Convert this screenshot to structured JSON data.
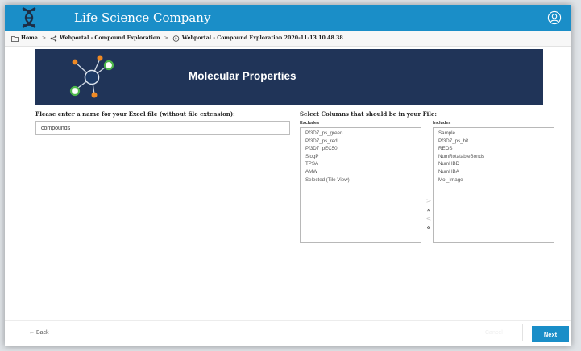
{
  "app": {
    "title": "Life Science Company",
    "brand_color": "#1a8ec8",
    "banner_color": "#203458"
  },
  "breadcrumb": {
    "home": "Home",
    "item1": "Webportal - Compound Exploration",
    "item2": "Webportal - Compound Exploration 2020-11-13 10.48.38"
  },
  "banner": {
    "title": "Molecular Properties"
  },
  "filename": {
    "label": "Please enter a name for your Excel file (without file extension):",
    "value": "compounds"
  },
  "columns": {
    "label": "Select Columns that should be in your File:",
    "excludes_header": "Excludes",
    "includes_header": "Includes",
    "excludes": [
      "Pf3D7_ps_green",
      "Pf3D7_ps_red",
      "Pf3D7_pEC50",
      "SlogP",
      "TPSA",
      "AMW",
      "Selected (Tile View)"
    ],
    "includes": [
      "Sample",
      "Pf3D7_ps_hit",
      "REOS",
      "NumRotatableBonds",
      "NumHBD",
      "NumHBA",
      "Mol_Image"
    ],
    "arrows": {
      "move_one_right": ">",
      "move_all_right": "»",
      "move_one_left": "<",
      "move_all_left": "«"
    }
  },
  "footer": {
    "back_label": "Back",
    "cancel_label": "Cancel",
    "next_label": "Next"
  }
}
